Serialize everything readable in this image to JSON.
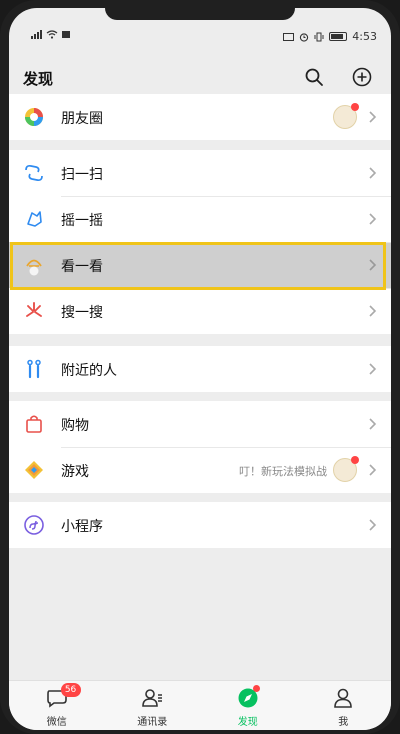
{
  "status_bar": {
    "time": "4:53",
    "battery": "80"
  },
  "header": {
    "title": "发现"
  },
  "groups": {
    "moments": {
      "label": "朋友圈"
    },
    "scan": {
      "label": "扫一扫"
    },
    "shake": {
      "label": "摇一摇"
    },
    "top_stories": {
      "label": "看一看"
    },
    "search": {
      "label": "搜一搜"
    },
    "nearby": {
      "label": "附近的人"
    },
    "shopping": {
      "label": "购物"
    },
    "games": {
      "label": "游戏",
      "subtitle": "叮！新玩法模拟战"
    },
    "mini_programs": {
      "label": "小程序"
    }
  },
  "tabbar": {
    "chats": {
      "label": "微信",
      "badge": "56"
    },
    "contacts": {
      "label": "通讯录"
    },
    "discover": {
      "label": "发现"
    },
    "me": {
      "label": "我"
    }
  },
  "colors": {
    "accent_green": "#07c160",
    "badge_red": "#ff4444",
    "highlight_border": "#f0c419"
  }
}
